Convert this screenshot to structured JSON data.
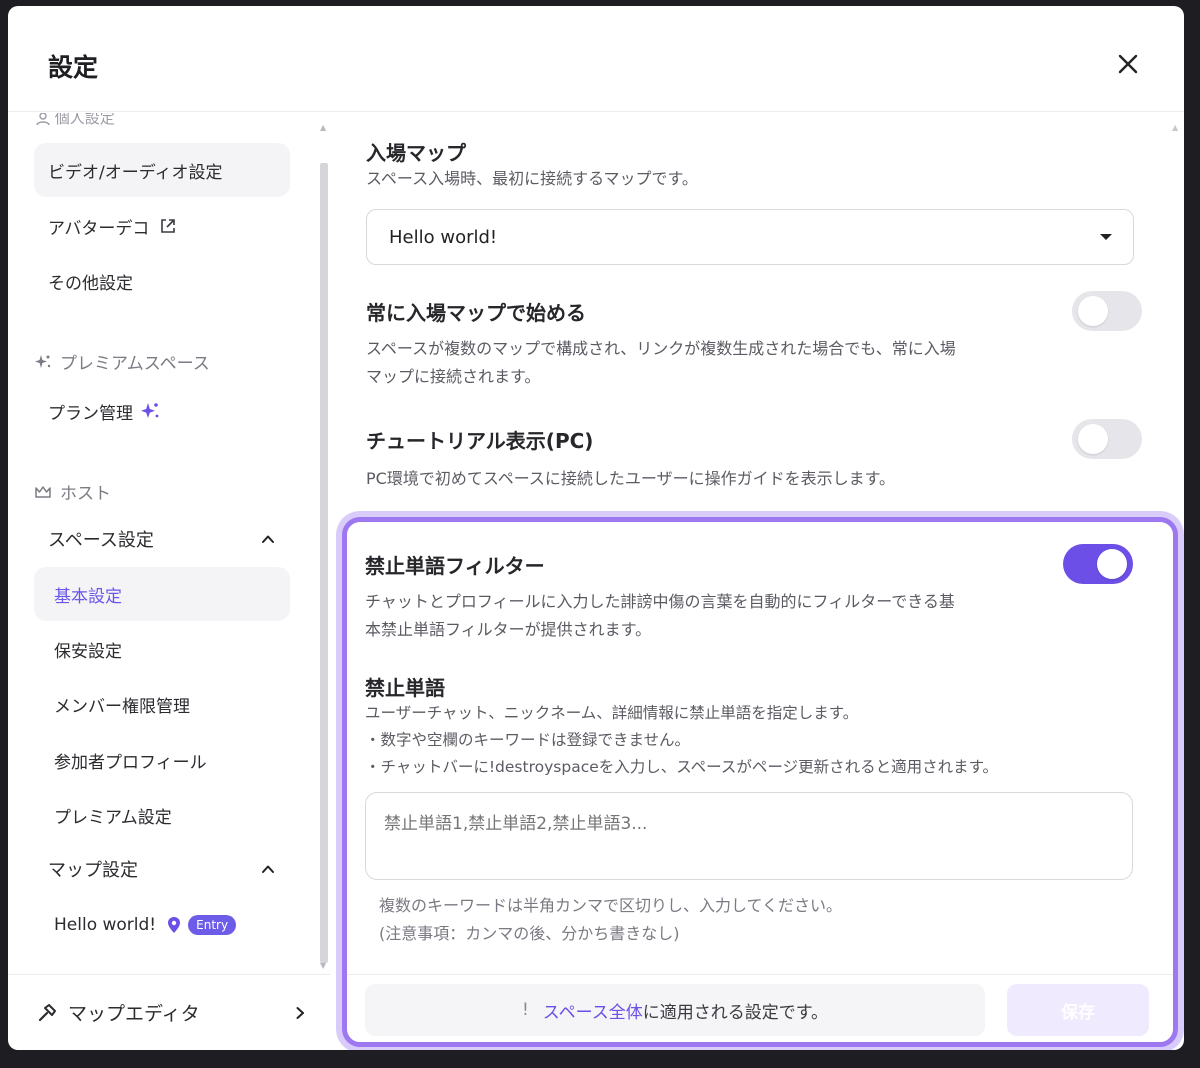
{
  "modal": {
    "title": "設定"
  },
  "sidebar": {
    "cut_section_label": "個人設定",
    "personal_items": [
      {
        "label": "ビデオ/オーディオ設定"
      },
      {
        "label": "アバターデコ"
      },
      {
        "label": "その他設定"
      }
    ],
    "premium_section": "プレミアムスペース",
    "plan_label": "プラン管理",
    "host_section": "ホスト",
    "space_settings_group": "スペース設定",
    "space_items": [
      {
        "label": "基本設定"
      },
      {
        "label": "保安設定"
      },
      {
        "label": "メンバー権限管理"
      },
      {
        "label": "参加者プロフィール"
      },
      {
        "label": "プレミアム設定"
      }
    ],
    "map_settings_group": "マップ設定",
    "map_item": {
      "label": "Hello world!",
      "badge": "Entry"
    },
    "footer_label": "マップエディタ"
  },
  "main": {
    "entry_map": {
      "label": "入場マップ",
      "desc": "スペース入場時、最初に接続するマップです。",
      "selected": "Hello world!"
    },
    "always_entry": {
      "label": "常に入場マップで始める",
      "desc_line1": "スペースが複数のマップで構成され、リンクが複数生成された場合でも、常に入場",
      "desc_line2": "マップに接続されます。",
      "enabled": false
    },
    "tutorial": {
      "label": "チュートリアル表示(PC)",
      "desc": "PC環境で初めてスペースに接続したユーザーに操作ガイドを表示します。",
      "enabled": false
    },
    "filter": {
      "label": "禁止単語フィルター",
      "desc_line1": "チャットとプロフィールに入力した誹謗中傷の言葉を自動的にフィルターできる基",
      "desc_line2": "本禁止単語フィルターが提供されます。",
      "enabled": true
    },
    "banned_words": {
      "label": "禁止単語",
      "desc_line1": "ユーザーチャット、ニックネーム、詳細情報に禁止単語を指定します。",
      "desc_line2": "・数字や空欄のキーワードは登録できません。",
      "desc_line3": "・チャットバーに!destroyspaceを入力し、スペースがページ更新されると適用されます。",
      "placeholder": "禁止単語1,禁止単語2,禁止単語3...",
      "hint_line1": "複数のキーワードは半角カンマで区切りし、入力してください。",
      "hint_line2": "(注意事項：カンマの後、分かち書きなし)"
    },
    "notice": {
      "icon": "!",
      "accent": "スペース全体",
      "rest": "に適用される設定です。"
    },
    "save_label": "保存"
  },
  "colors": {
    "accent": "#6c4fe6",
    "highlight": "#9d78f1"
  }
}
